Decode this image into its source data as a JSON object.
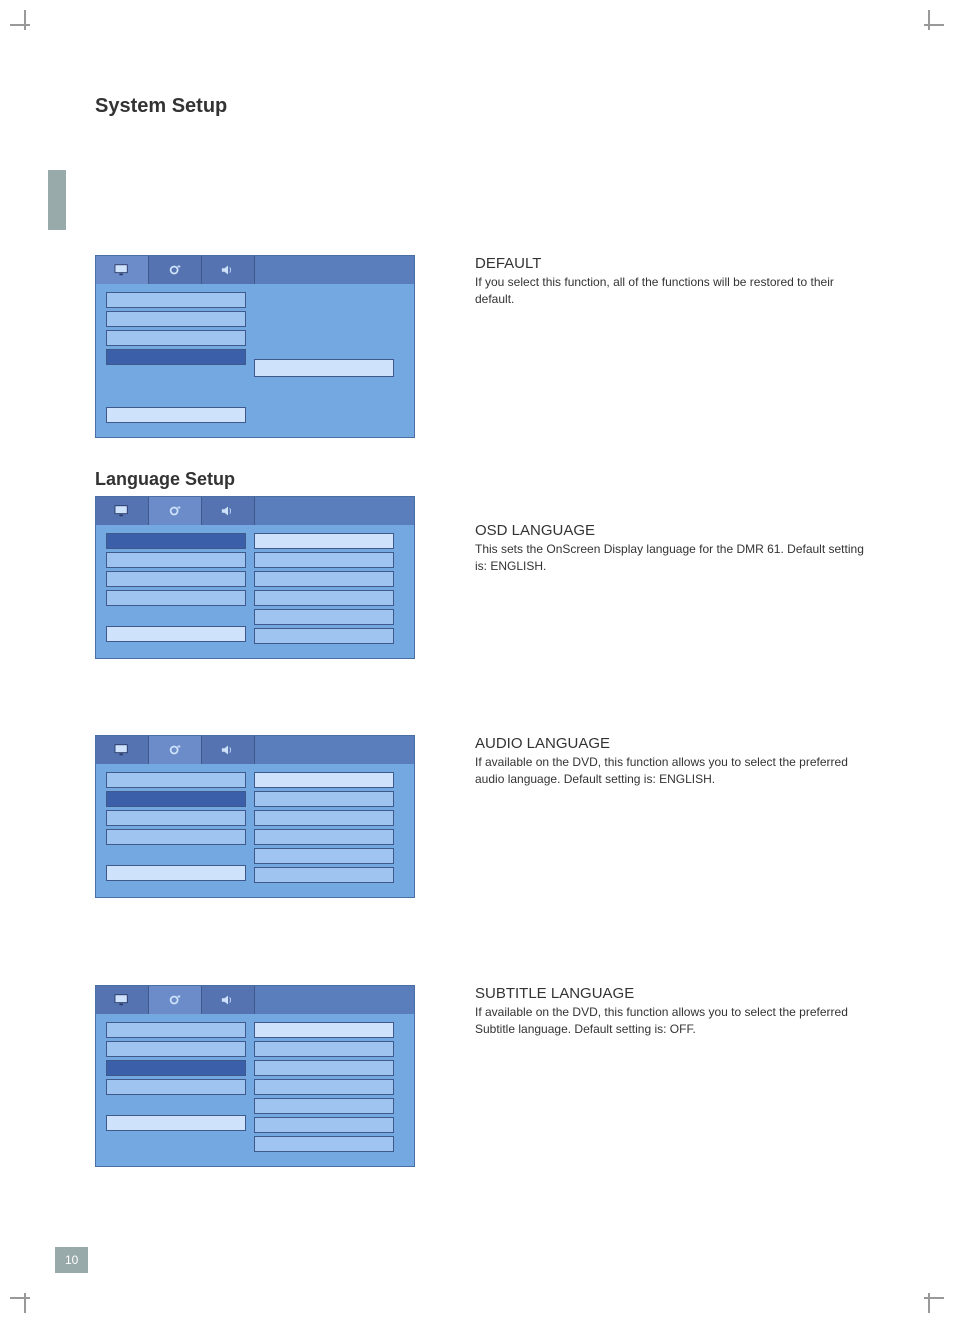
{
  "page_number": "10",
  "heading_main": "System Setup",
  "heading_lang": "Language Setup",
  "sections": {
    "default": {
      "title": "DEFAULT",
      "body": "If you select this function, all of the functions will be restored to their default."
    },
    "osd": {
      "title": "OSD LANGUAGE",
      "body": "This sets the OnScreen Display language for the DMR 61. Default setting is: ENGLISH."
    },
    "audio": {
      "title": "AUDIO LANGUAGE",
      "body": "If available on the DVD, this function allows you to select the preferred audio language. Default setting is: ENGLISH."
    },
    "subtitle": {
      "title": "SUBTITLE LANGUAGE",
      "body": "If available on the DVD, this function allows you to select the preferred Subtitle language. Default setting is: OFF."
    }
  },
  "osd_tabs": [
    "monitor-icon",
    "settings-icon",
    "speaker-icon"
  ],
  "menus": {
    "default_panel": {
      "rows": 3,
      "selected_index": 3,
      "footer_buttons": 1,
      "right_button": true
    },
    "osd_panel": {
      "rows": 4,
      "selected_index": 0,
      "footer_buttons": 1,
      "right_rows": 6
    },
    "audio_panel": {
      "rows": 4,
      "selected_index": 1,
      "footer_buttons": 1,
      "right_rows": 6
    },
    "subtitle_panel": {
      "rows": 4,
      "selected_index": 2,
      "footer_buttons": 1,
      "right_rows": 7
    }
  }
}
